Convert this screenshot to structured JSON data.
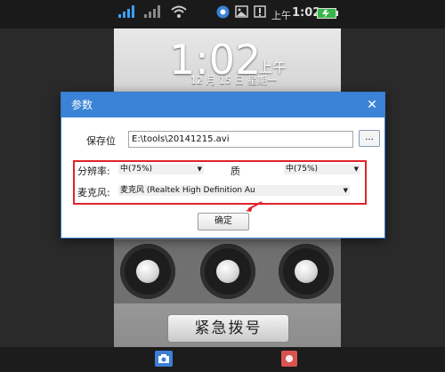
{
  "status_bar": {
    "time": "1:02",
    "ampm": "上午"
  },
  "lockscreen": {
    "clock": "1:02",
    "ampm": "上午",
    "date": "12 月 15 日 星期一",
    "emergency_label": "紧急拨号"
  },
  "dialog": {
    "title": "参数",
    "close_glyph": "✕",
    "save_location_label": "保存位",
    "save_location_value": "E:\\tools\\20141215.avi",
    "browse_label": "...",
    "resolution_label": "分辨率:",
    "resolution_value": "中(75%)",
    "quality_label": "质",
    "quality_value": "中(75%)",
    "microphone_label": "麦克风:",
    "microphone_value": "麦克风 (Realtek High Definition Au",
    "ok_label": "确定"
  },
  "colors": {
    "accent": "#3a83d6",
    "highlight_box": "#e0242b"
  },
  "icons": [
    "signal-icon",
    "no-signal-icon",
    "wifi-icon",
    "app-icon",
    "photo-icon",
    "battery-icon",
    "camera-icon",
    "record-icon"
  ]
}
